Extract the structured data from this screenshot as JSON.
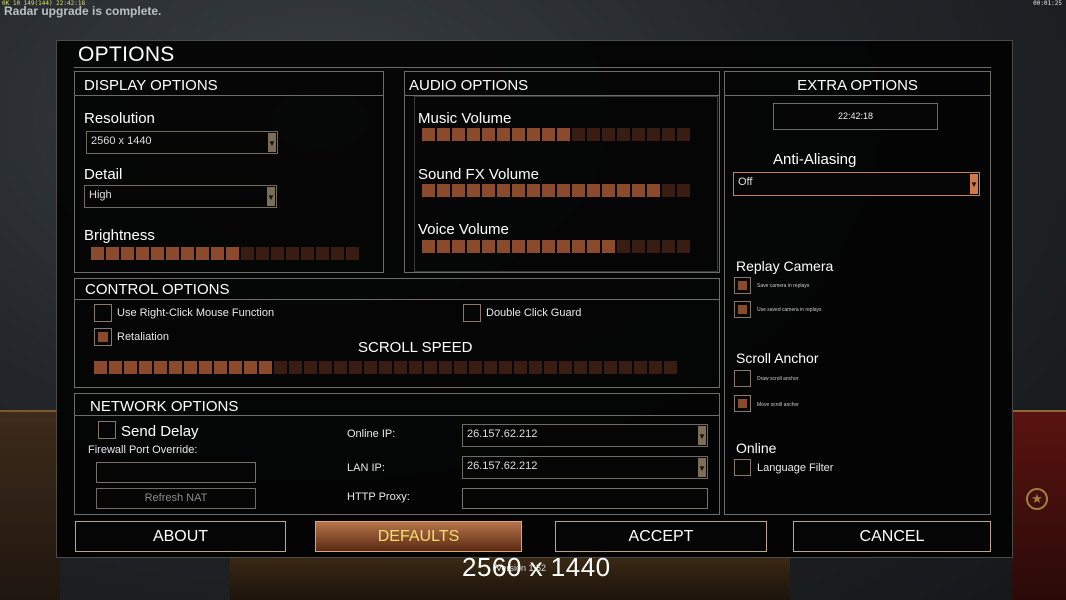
{
  "hud": {
    "top_left": "0K 10 149(144) 22:42:18",
    "top_right": "00:01:25",
    "message": "Radar upgrade is complete."
  },
  "dialog": {
    "title": "OPTIONS"
  },
  "display": {
    "title": "DISPLAY OPTIONS",
    "resolution_label": "Resolution",
    "resolution_value": "2560 x 1440",
    "detail_label": "Detail",
    "detail_value": "High",
    "brightness_label": "Brightness",
    "brightness_level": 0.58
  },
  "audio": {
    "title": "AUDIO OPTIONS",
    "music_label": "Music Volume",
    "music_level": 0.55,
    "sfx_label": "Sound FX Volume",
    "sfx_level": 0.88,
    "voice_label": "Voice Volume",
    "voice_level": 0.7
  },
  "extra": {
    "title": "EXTRA OPTIONS",
    "clock": "22:42:18",
    "aa_label": "Anti-Aliasing",
    "aa_value": "Off",
    "replay_label": "Replay Camera",
    "save_camera": "Save camera in replays",
    "use_camera": "Use saved camera in replays",
    "scroll_anchor_label": "Scroll Anchor",
    "draw_anchor": "Draw scroll anchor",
    "move_anchor": "Move scroll anchor",
    "online_label": "Online",
    "language_filter": "Language Filter"
  },
  "control": {
    "title": "CONTROL OPTIONS",
    "right_click": "Use Right-Click Mouse Function",
    "double_click": "Double Click Guard",
    "retaliation": "Retaliation",
    "scroll_speed_label": "SCROLL SPEED",
    "scroll_speed_level": 0.3
  },
  "network": {
    "title": "NETWORK OPTIONS",
    "send_delay": "Send Delay",
    "firewall_label": "Firewall Port Override:",
    "refresh_nat": "Refresh NAT",
    "online_ip_label": "Online IP:",
    "online_ip_value": "26.157.62.212",
    "lan_ip_label": "LAN IP:",
    "lan_ip_value": "26.157.62.212",
    "http_proxy_label": "HTTP Proxy:"
  },
  "buttons": {
    "about": "ABOUT",
    "defaults": "DEFAULTS",
    "accept": "ACCEPT",
    "cancel": "CANCEL"
  },
  "overlay": {
    "resolution_text": "2560 x 1440",
    "version_text": "Version 1.52"
  },
  "checks": {
    "right_click": false,
    "double_click": false,
    "retaliation": true,
    "send_delay": false,
    "save_camera": true,
    "use_camera": true,
    "draw_anchor": false,
    "move_anchor": true,
    "language_filter": false
  },
  "colors": {
    "accent": "#8c4a2c",
    "accent_dim": "#3a1d12",
    "defaults_text": "#f0e06c"
  }
}
